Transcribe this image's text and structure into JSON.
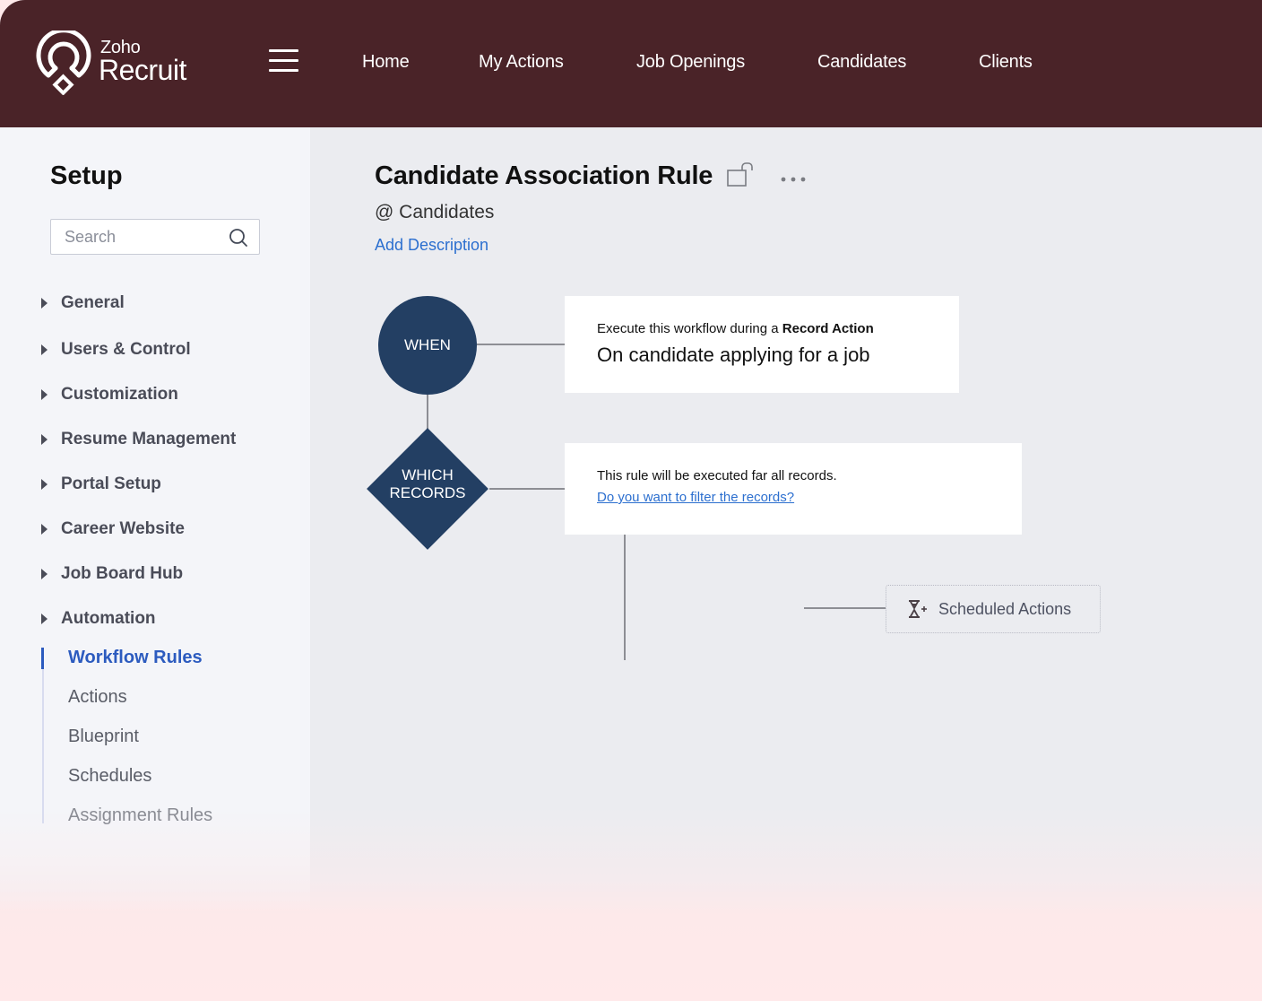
{
  "brand": {
    "company": "Zoho",
    "product": "Recruit",
    "header_color": "#4a2328"
  },
  "nav": {
    "items": [
      {
        "label": "Home"
      },
      {
        "label": "My Actions"
      },
      {
        "label": "Job Openings"
      },
      {
        "label": "Candidates"
      },
      {
        "label": "Clients"
      }
    ]
  },
  "sidebar": {
    "title": "Setup",
    "search_placeholder": "Search",
    "sections": [
      {
        "label": "General"
      },
      {
        "label": "Users & Control"
      },
      {
        "label": "Customization"
      },
      {
        "label": "Resume Management"
      },
      {
        "label": "Portal Setup"
      },
      {
        "label": "Career Website"
      },
      {
        "label": "Job Board Hub"
      },
      {
        "label": "Automation"
      }
    ],
    "automation_items": [
      {
        "label": "Workflow Rules",
        "active": true
      },
      {
        "label": "Actions"
      },
      {
        "label": "Blueprint"
      },
      {
        "label": "Schedules"
      },
      {
        "label": "Assignment Rules"
      }
    ],
    "active_color": "#2c5bbf"
  },
  "rule": {
    "title": "Candidate Association Rule",
    "module": "@ Candidates",
    "add_description": "Add Description",
    "when": {
      "node_label": "WHEN",
      "prefix": "Execute this workflow during a",
      "trigger_type": "Record Action",
      "trigger": "On candidate applying for a job"
    },
    "which": {
      "node_label_line1": "WHICH",
      "node_label_line2": "RECORDS",
      "description": "This rule will be executed far all records.",
      "filter_link": "Do you want to filter the records?"
    },
    "scheduled_actions_label": "Scheduled Actions",
    "node_color": "#233f63"
  }
}
